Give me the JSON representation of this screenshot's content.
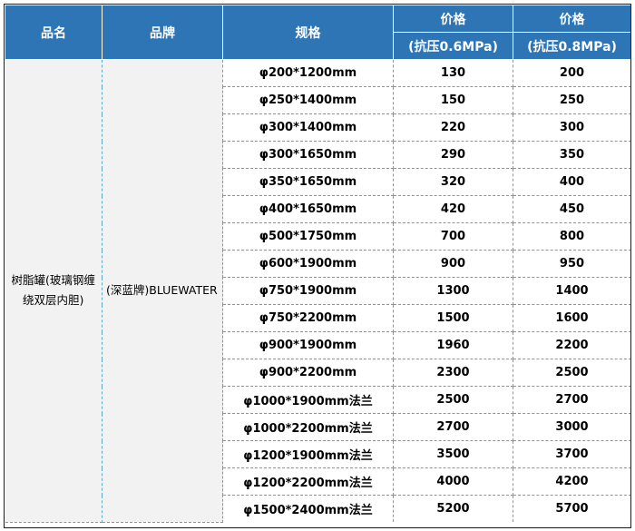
{
  "table": {
    "headers": {
      "name": "品名",
      "brand": "品牌",
      "spec": "规格",
      "price_a_title": "价格",
      "price_a_sub": "(抗压0.6MPa)",
      "price_b_title": "价格",
      "price_b_sub": "(抗压0.8MPa)"
    },
    "product_name": "树脂罐(玻璃钢缠绕双层内胆)",
    "brand": "(深蓝牌)BLUEWATER",
    "rows": [
      {
        "spec": "φ200*1200mm",
        "p06": "130",
        "p08": "200"
      },
      {
        "spec": "φ250*1400mm",
        "p06": "150",
        "p08": "250"
      },
      {
        "spec": "φ300*1400mm",
        "p06": "220",
        "p08": "300"
      },
      {
        "spec": "φ300*1650mm",
        "p06": "290",
        "p08": "350"
      },
      {
        "spec": "φ350*1650mm",
        "p06": "320",
        "p08": "400"
      },
      {
        "spec": "φ400*1650mm",
        "p06": "420",
        "p08": "450"
      },
      {
        "spec": "φ500*1750mm",
        "p06": "700",
        "p08": "800"
      },
      {
        "spec": "φ600*1900mm",
        "p06": "900",
        "p08": "950"
      },
      {
        "spec": "φ750*1900mm",
        "p06": "1300",
        "p08": "1400"
      },
      {
        "spec": "φ750*2200mm",
        "p06": "1500",
        "p08": "1600"
      },
      {
        "spec": "φ900*1900mm",
        "p06": "1960",
        "p08": "2200"
      },
      {
        "spec": "φ900*2200mm",
        "p06": "2300",
        "p08": "2500"
      },
      {
        "spec": "φ1000*1900mm法兰",
        "p06": "2500",
        "p08": "2700"
      },
      {
        "spec": "φ1000*2200mm法兰",
        "p06": "2700",
        "p08": "3000"
      },
      {
        "spec": "φ1200*1900mm法兰",
        "p06": "3500",
        "p08": "3700"
      },
      {
        "spec": "φ1200*2200mm法兰",
        "p06": "4000",
        "p08": "4200"
      },
      {
        "spec": "φ1500*2400mm法兰",
        "p06": "5200",
        "p08": "5700"
      }
    ]
  },
  "colors": {
    "header_bg": "#2e75b6",
    "header_text": "#ffffff",
    "grid_line": "#5aa6c8",
    "merged_cell_bg": "#f2f2f2"
  }
}
